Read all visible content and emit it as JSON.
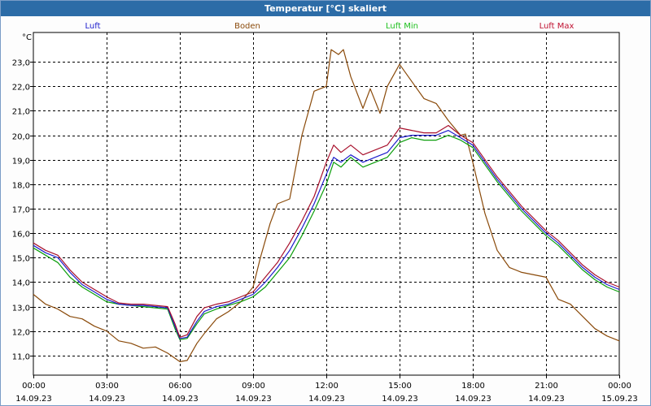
{
  "window": {
    "title": "Temperatur [°C] skaliert"
  },
  "chart_data": {
    "type": "line",
    "title": "Temperatur [°C] skaliert",
    "ylabel": "°C",
    "xlabel": "",
    "ylim": [
      10.2,
      24.2
    ],
    "xlim": [
      0,
      24
    ],
    "grid": true,
    "legend_position": "top",
    "yticks": [
      11.0,
      12.0,
      13.0,
      14.0,
      15.0,
      16.0,
      17.0,
      18.0,
      19.0,
      20.0,
      21.0,
      22.0,
      23.0
    ],
    "ytick_labels": [
      "11,0",
      "12,0",
      "13,0",
      "14,0",
      "15,0",
      "16,0",
      "17,0",
      "18,0",
      "19,0",
      "20,0",
      "21,0",
      "22,0",
      "23,0"
    ],
    "xticks": [
      {
        "x": 0,
        "time": "00:00",
        "date": "14.09.23"
      },
      {
        "x": 3,
        "time": "03:00",
        "date": "14.09.23"
      },
      {
        "x": 6,
        "time": "06:00",
        "date": "14.09.23"
      },
      {
        "x": 9,
        "time": "09:00",
        "date": "14.09.23"
      },
      {
        "x": 12,
        "time": "12:00",
        "date": "14.09.23"
      },
      {
        "x": 15,
        "time": "15:00",
        "date": "14.09.23"
      },
      {
        "x": 18,
        "time": "18:00",
        "date": "14.09.23"
      },
      {
        "x": 21,
        "time": "21:00",
        "date": "14.09.23"
      },
      {
        "x": 24,
        "time": "00:00",
        "date": "15.09.23"
      }
    ],
    "series": [
      {
        "name": "Luft",
        "color": "#1c1ccc",
        "legend_color": "#1c1ccc",
        "points": [
          [
            0,
            15.5
          ],
          [
            0.5,
            15.2
          ],
          [
            1,
            15.0
          ],
          [
            1.5,
            14.4
          ],
          [
            2,
            13.9
          ],
          [
            2.5,
            13.6
          ],
          [
            3,
            13.3
          ],
          [
            3.5,
            13.1
          ],
          [
            4,
            13.05
          ],
          [
            4.5,
            13.05
          ],
          [
            5,
            13.0
          ],
          [
            5.5,
            12.95
          ],
          [
            5.8,
            12.2
          ],
          [
            6,
            11.7
          ],
          [
            6.3,
            11.75
          ],
          [
            6.7,
            12.4
          ],
          [
            7,
            12.8
          ],
          [
            7.5,
            13.0
          ],
          [
            8,
            13.1
          ],
          [
            8.5,
            13.3
          ],
          [
            9,
            13.5
          ],
          [
            9.5,
            14.0
          ],
          [
            10,
            14.6
          ],
          [
            10.5,
            15.3
          ],
          [
            11,
            16.2
          ],
          [
            11.5,
            17.2
          ],
          [
            12,
            18.4
          ],
          [
            12.3,
            19.1
          ],
          [
            12.6,
            18.9
          ],
          [
            13,
            19.2
          ],
          [
            13.5,
            18.9
          ],
          [
            14,
            19.1
          ],
          [
            14.5,
            19.3
          ],
          [
            15,
            19.9
          ],
          [
            15.5,
            20.0
          ],
          [
            16,
            20.0
          ],
          [
            16.5,
            20.0
          ],
          [
            17,
            20.2
          ],
          [
            17.5,
            19.9
          ],
          [
            18,
            19.6
          ],
          [
            18.5,
            18.9
          ],
          [
            19,
            18.2
          ],
          [
            19.5,
            17.6
          ],
          [
            20,
            17.0
          ],
          [
            20.5,
            16.5
          ],
          [
            21,
            16.0
          ],
          [
            21.5,
            15.6
          ],
          [
            22,
            15.1
          ],
          [
            22.5,
            14.6
          ],
          [
            23,
            14.2
          ],
          [
            23.5,
            13.9
          ],
          [
            24,
            13.7
          ]
        ]
      },
      {
        "name": "Boden",
        "color": "#8a4a0a",
        "legend_color": "#8a4a0a",
        "points": [
          [
            0,
            13.5
          ],
          [
            0.5,
            13.1
          ],
          [
            1,
            12.9
          ],
          [
            1.5,
            12.6
          ],
          [
            2,
            12.5
          ],
          [
            2.5,
            12.2
          ],
          [
            3,
            12.0
          ],
          [
            3.5,
            11.6
          ],
          [
            4,
            11.5
          ],
          [
            4.5,
            11.3
          ],
          [
            5,
            11.35
          ],
          [
            5.5,
            11.1
          ],
          [
            6,
            10.75
          ],
          [
            6.3,
            10.8
          ],
          [
            6.7,
            11.5
          ],
          [
            7,
            11.9
          ],
          [
            7.5,
            12.5
          ],
          [
            8,
            12.8
          ],
          [
            8.5,
            13.2
          ],
          [
            9,
            13.8
          ],
          [
            9.3,
            15.0
          ],
          [
            9.7,
            16.4
          ],
          [
            10,
            17.2
          ],
          [
            10.5,
            17.4
          ],
          [
            11,
            20.0
          ],
          [
            11.5,
            21.8
          ],
          [
            12,
            22.0
          ],
          [
            12.2,
            23.5
          ],
          [
            12.5,
            23.3
          ],
          [
            12.7,
            23.5
          ],
          [
            13,
            22.4
          ],
          [
            13.5,
            21.1
          ],
          [
            13.8,
            21.9
          ],
          [
            14.2,
            20.9
          ],
          [
            14.5,
            22.0
          ],
          [
            15,
            22.9
          ],
          [
            15.5,
            22.2
          ],
          [
            16,
            21.5
          ],
          [
            16.5,
            21.3
          ],
          [
            17,
            20.6
          ],
          [
            17.5,
            20.0
          ],
          [
            17.7,
            20.05
          ],
          [
            18,
            18.9
          ],
          [
            18.5,
            16.8
          ],
          [
            19,
            15.3
          ],
          [
            19.5,
            14.6
          ],
          [
            20,
            14.4
          ],
          [
            20.5,
            14.3
          ],
          [
            21,
            14.2
          ],
          [
            21.5,
            13.3
          ],
          [
            22,
            13.1
          ],
          [
            22.5,
            12.6
          ],
          [
            23,
            12.1
          ],
          [
            23.5,
            11.8
          ],
          [
            24,
            11.6
          ]
        ]
      },
      {
        "name": "Luft Min",
        "color": "#0a9e0a",
        "legend_color": "#1ec01e",
        "points": [
          [
            0,
            15.4
          ],
          [
            0.5,
            15.1
          ],
          [
            1,
            14.8
          ],
          [
            1.5,
            14.2
          ],
          [
            2,
            13.8
          ],
          [
            2.5,
            13.5
          ],
          [
            3,
            13.2
          ],
          [
            3.5,
            13.1
          ],
          [
            4,
            13.05
          ],
          [
            4.5,
            13.0
          ],
          [
            5,
            12.95
          ],
          [
            5.5,
            12.9
          ],
          [
            5.8,
            12.1
          ],
          [
            6,
            11.65
          ],
          [
            6.3,
            11.7
          ],
          [
            6.7,
            12.3
          ],
          [
            7,
            12.7
          ],
          [
            7.5,
            12.9
          ],
          [
            8,
            13.05
          ],
          [
            8.5,
            13.2
          ],
          [
            9,
            13.4
          ],
          [
            9.5,
            13.8
          ],
          [
            10,
            14.4
          ],
          [
            10.5,
            15.0
          ],
          [
            11,
            15.9
          ],
          [
            11.5,
            16.9
          ],
          [
            12,
            18.0
          ],
          [
            12.3,
            18.9
          ],
          [
            12.6,
            18.7
          ],
          [
            13,
            19.1
          ],
          [
            13.5,
            18.7
          ],
          [
            14,
            18.9
          ],
          [
            14.5,
            19.1
          ],
          [
            15,
            19.7
          ],
          [
            15.5,
            19.9
          ],
          [
            16,
            19.8
          ],
          [
            16.5,
            19.8
          ],
          [
            17,
            20.0
          ],
          [
            17.5,
            19.8
          ],
          [
            18,
            19.5
          ],
          [
            18.5,
            18.8
          ],
          [
            19,
            18.1
          ],
          [
            19.5,
            17.5
          ],
          [
            20,
            16.9
          ],
          [
            20.5,
            16.4
          ],
          [
            21,
            15.9
          ],
          [
            21.5,
            15.5
          ],
          [
            22,
            15.0
          ],
          [
            22.5,
            14.5
          ],
          [
            23,
            14.1
          ],
          [
            23.5,
            13.8
          ],
          [
            24,
            13.6
          ]
        ]
      },
      {
        "name": "Luft Max",
        "color": "#a8102c",
        "legend_color": "#c01030",
        "points": [
          [
            0,
            15.6
          ],
          [
            0.5,
            15.3
          ],
          [
            1,
            15.1
          ],
          [
            1.5,
            14.5
          ],
          [
            2,
            14.0
          ],
          [
            2.5,
            13.7
          ],
          [
            3,
            13.4
          ],
          [
            3.5,
            13.15
          ],
          [
            4,
            13.1
          ],
          [
            4.5,
            13.1
          ],
          [
            5,
            13.05
          ],
          [
            5.5,
            13.0
          ],
          [
            5.8,
            12.3
          ],
          [
            6,
            11.75
          ],
          [
            6.3,
            11.85
          ],
          [
            6.7,
            12.6
          ],
          [
            7,
            12.95
          ],
          [
            7.5,
            13.1
          ],
          [
            8,
            13.2
          ],
          [
            8.5,
            13.4
          ],
          [
            9,
            13.6
          ],
          [
            9.5,
            14.2
          ],
          [
            10,
            14.8
          ],
          [
            10.5,
            15.6
          ],
          [
            11,
            16.5
          ],
          [
            11.5,
            17.5
          ],
          [
            12,
            18.9
          ],
          [
            12.3,
            19.6
          ],
          [
            12.6,
            19.3
          ],
          [
            13,
            19.6
          ],
          [
            13.5,
            19.2
          ],
          [
            14,
            19.4
          ],
          [
            14.5,
            19.6
          ],
          [
            15,
            20.3
          ],
          [
            15.5,
            20.2
          ],
          [
            16,
            20.1
          ],
          [
            16.5,
            20.1
          ],
          [
            17,
            20.4
          ],
          [
            17.5,
            20.0
          ],
          [
            18,
            19.7
          ],
          [
            18.5,
            19.0
          ],
          [
            19,
            18.3
          ],
          [
            19.5,
            17.7
          ],
          [
            20,
            17.1
          ],
          [
            20.5,
            16.6
          ],
          [
            21,
            16.1
          ],
          [
            21.5,
            15.7
          ],
          [
            22,
            15.2
          ],
          [
            22.5,
            14.7
          ],
          [
            23,
            14.3
          ],
          [
            23.5,
            14.0
          ],
          [
            24,
            13.8
          ]
        ]
      }
    ]
  }
}
